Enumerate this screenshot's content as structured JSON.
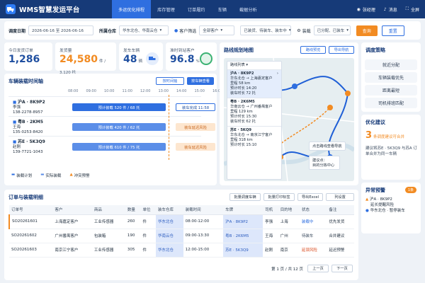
{
  "header": {
    "title": "WMS智慧发运平台",
    "nav": [
      "多运优化排程",
      "库存管理",
      "订单履约",
      "车辆",
      "截据分析"
    ],
    "user": "张经理",
    "messages": "消息",
    "fullscreen": "全屏"
  },
  "filters": {
    "date_label": "调度日期",
    "date_value": "2026-06-16 至 2026-06-16",
    "warehouse_label": "所属仓库",
    "warehouse_value": "华东北仓、华南云仓",
    "customer_placeholder": "客户筛选",
    "customer_value": "全部客户",
    "status_value": "已装货、待装车、装车中",
    "load_label": "装载",
    "load_value": "已分配、已装车",
    "query": "查询",
    "reset": "重置"
  },
  "kpis": [
    {
      "label": "今日发货订单",
      "value": "1,286",
      "sub": "",
      "color": "#1f4fa0"
    },
    {
      "label": "发货量",
      "value": "24,580",
      "sub": "件 / 3,120 托",
      "color": "#f28b22"
    },
    {
      "label": "发车车辆",
      "value": "48",
      "sub": "辆",
      "color": "#1f4fa0"
    },
    {
      "label": "准时到站客户",
      "value": "96.8",
      "sub": "%",
      "color": "#1f4fa0"
    }
  ],
  "timeline": {
    "title": "车辆装载时间轴",
    "btn1": "按时间轴",
    "btn2": "按车辆查看",
    "ticks": [
      "08:00",
      "09:00",
      "10:00",
      "11:00",
      "12:00",
      "13:00",
      "14:00",
      "15:00",
      "16:00"
    ],
    "vehicles": [
      {
        "plate": "沪A · 8K9P2",
        "driver": "李强",
        "phone": "138-2278-8957",
        "bar": "预计装载 520 件 / 68 托",
        "status": "装车完成 11:58"
      },
      {
        "plate": "粤B · 2KM5",
        "driver": "王海",
        "phone": "135-0253-8420",
        "bar": "预计装载 420 件 / 62 托",
        "status": "装车延迟风险"
      },
      {
        "plate": "苏E · 5K3Q9",
        "driver": "赵刚",
        "phone": "139-7721-1043",
        "bar": "预计装载 610 件 / 75 托",
        "status": "装车延迟风险"
      }
    ],
    "legend": [
      "装载计划",
      "实际装载",
      "冲突预警"
    ]
  },
  "map": {
    "title": "路线规划地图",
    "btn1": "路线预览",
    "btn2": "导出导航",
    "list_title": "路线列表",
    "routes": [
      {
        "plate": "沪A · 8K9P2",
        "lines": [
          "华东北仓 → 上海嘉定客户",
          "里程 58 km",
          "预计时长 14:20",
          "装车时长 72 托"
        ]
      },
      {
        "plate": "粤B · 2K6M5",
        "lines": [
          "华南云仓 → 广州番禺客户",
          "里程 129 km",
          "预计时长 15:30",
          "装车时长 62 托"
        ]
      },
      {
        "plate": "苏E · 5KQ9",
        "lines": [
          "华东北仓 → 南京江宁客户",
          "里程 318 km",
          "预计时长 15:10"
        ]
      }
    ],
    "tip1": "点击路线查看导航",
    "tip2": "建议点：\n目的分拣中心"
  },
  "strategy": {
    "title": "调度策略",
    "items": [
      "就近分配",
      "车辆装载优先",
      "距离最短",
      "司机排班匹配"
    ]
  },
  "suggest": {
    "title": "优化建议",
    "count": "3",
    "count_text": "条调度建议可合并",
    "desc": "建议将苏E · 5K3Q9 与苏A 订单合并为同一车辆"
  },
  "alert": {
    "title": "异常预警",
    "badge": "1条",
    "line1": "沪A · 8K9P2",
    "line2": "延长提醒风险",
    "line3": "华东北仓 · 暂停装车"
  },
  "orders": {
    "title": "订单与装载明细",
    "btns": [
      "批量调度车辆",
      "批量打印标签",
      "导出Excel",
      "列设置"
    ],
    "columns": [
      "订单号",
      "客户",
      "商品",
      "数量",
      "单位",
      "装车仓库",
      "装载时间",
      "车牌",
      "司机",
      "目的地",
      "状态",
      "备注"
    ],
    "rows": [
      [
        "SO20261601",
        "上海嘉定客户",
        "工业传感器",
        "260",
        "件",
        "华东北仓",
        "08:00-12:00",
        "沪A · 8K9P2",
        "李强",
        "上海",
        "装载中",
        "优先发货"
      ],
      [
        "SO20261602",
        "广州番禺客户",
        "包装箱",
        "190",
        "件",
        "华南云仓",
        "09:00-13:30",
        "粤B · 2K6M5",
        "王海",
        "广州",
        "待装车",
        "合并建议"
      ],
      [
        "SO20261603",
        "南京江宁客户",
        "工业传感器",
        "305",
        "件",
        "华东北仓",
        "12:00-15:00",
        "苏E · 5K3Q9",
        "赵刚",
        "南京",
        "延误风险",
        "延迟预警"
      ]
    ],
    "pager": "第 1 页 / 共 12 页",
    "prev": "上一页",
    "next": "下一页"
  },
  "colors": {
    "brand": "#163a78",
    "accent": "#2f6fe0",
    "warn": "#f28b22"
  }
}
